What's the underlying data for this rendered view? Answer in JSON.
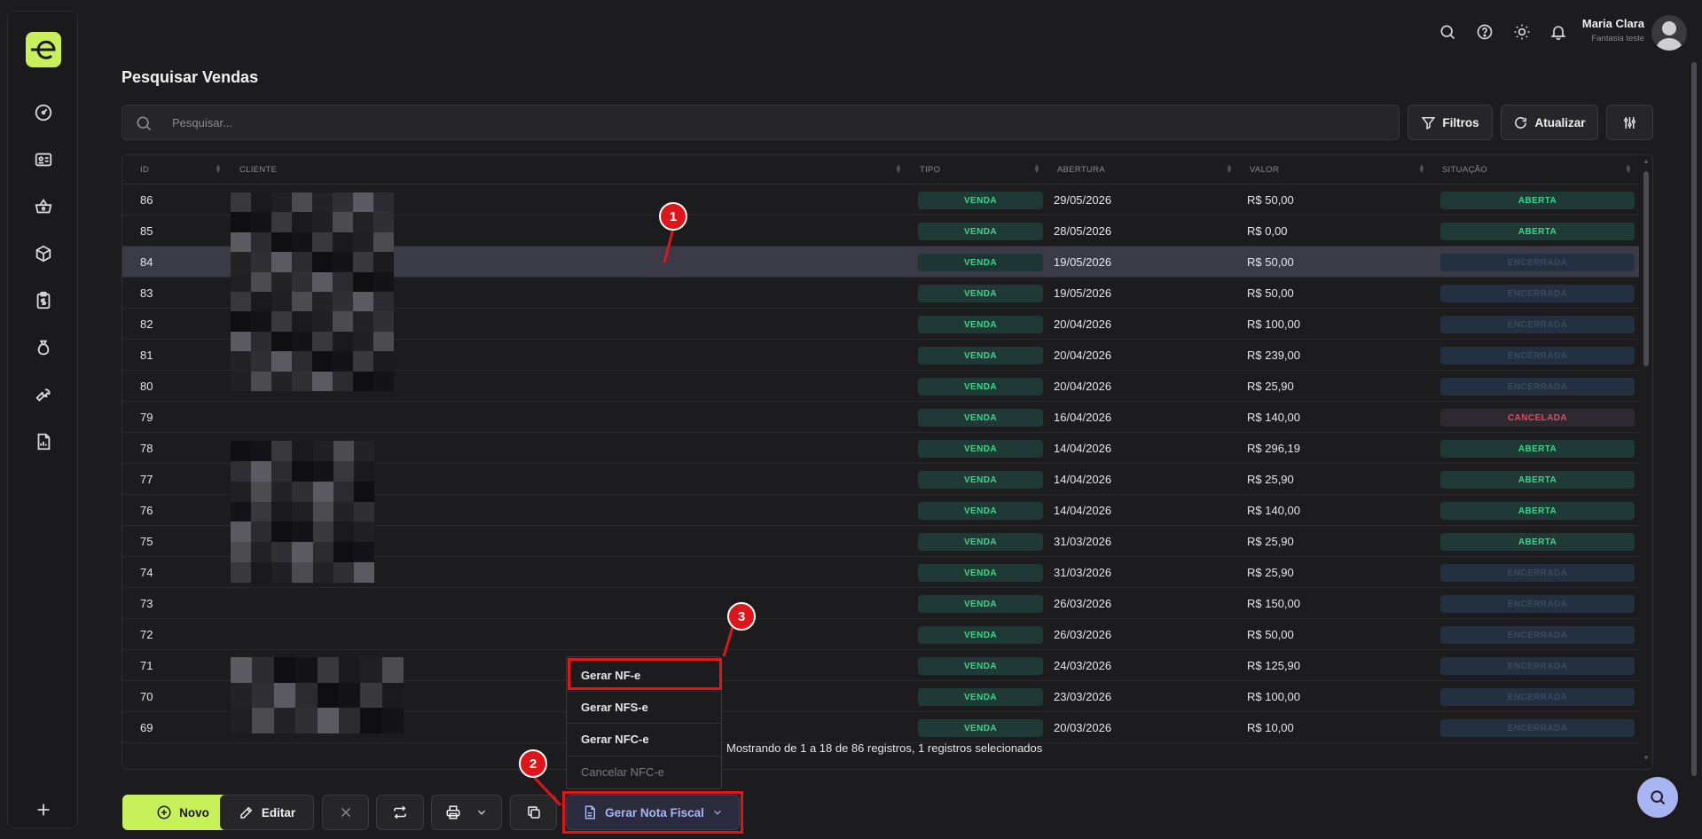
{
  "app": {
    "logo_text": "e",
    "accent": "#c8f05a"
  },
  "sidebar": {
    "items": [
      {
        "name": "dashboard-icon"
      },
      {
        "name": "id-card-icon"
      },
      {
        "name": "basket-icon"
      },
      {
        "name": "box-icon"
      },
      {
        "name": "clipboard-money-icon"
      },
      {
        "name": "money-bag-icon"
      },
      {
        "name": "wrench-icon"
      },
      {
        "name": "report-icon"
      }
    ],
    "add_icon": "plus-icon"
  },
  "topbar": {
    "user_name": "Maria Clara",
    "user_company": "Fantasia teste"
  },
  "page": {
    "title": "Pesquisar Vendas"
  },
  "search": {
    "placeholder": "Pesquisar..."
  },
  "toolbar": {
    "filters_label": "Filtros",
    "refresh_label": "Atualizar"
  },
  "table": {
    "columns": [
      "ID",
      "CLIENTE",
      "TIPO",
      "ABERTURA",
      "VALOR",
      "SITUAÇÃO"
    ],
    "rows": [
      {
        "id": "86",
        "tipo": "VENDA",
        "abertura": "29/05/2026",
        "valor": "R$ 50,00",
        "situacao": "ABERTA",
        "status": "aberta"
      },
      {
        "id": "85",
        "tipo": "VENDA",
        "abertura": "28/05/2026",
        "valor": "R$ 0,00",
        "situacao": "ABERTA",
        "status": "aberta"
      },
      {
        "id": "84",
        "tipo": "VENDA",
        "abertura": "19/05/2026",
        "valor": "R$ 50,00",
        "situacao": "ENCERRADA",
        "status": "encerrada",
        "selected": true
      },
      {
        "id": "83",
        "tipo": "VENDA",
        "abertura": "19/05/2026",
        "valor": "R$ 50,00",
        "situacao": "ENCERRADA",
        "status": "encerrada"
      },
      {
        "id": "82",
        "tipo": "VENDA",
        "abertura": "20/04/2026",
        "valor": "R$ 100,00",
        "situacao": "ENCERRADA",
        "status": "encerrada"
      },
      {
        "id": "81",
        "tipo": "VENDA",
        "abertura": "20/04/2026",
        "valor": "R$ 239,00",
        "situacao": "ENCERRADA",
        "status": "encerrada"
      },
      {
        "id": "80",
        "tipo": "VENDA",
        "abertura": "20/04/2026",
        "valor": "R$ 25,90",
        "situacao": "ENCERRADA",
        "status": "encerrada"
      },
      {
        "id": "79",
        "tipo": "VENDA",
        "abertura": "16/04/2026",
        "valor": "R$ 140,00",
        "situacao": "CANCELADA",
        "status": "cancelada"
      },
      {
        "id": "78",
        "tipo": "VENDA",
        "abertura": "14/04/2026",
        "valor": "R$ 296,19",
        "situacao": "ABERTA",
        "status": "aberta"
      },
      {
        "id": "77",
        "tipo": "VENDA",
        "abertura": "14/04/2026",
        "valor": "R$ 25,90",
        "situacao": "ABERTA",
        "status": "aberta"
      },
      {
        "id": "76",
        "tipo": "VENDA",
        "abertura": "14/04/2026",
        "valor": "R$ 140,00",
        "situacao": "ABERTA",
        "status": "aberta"
      },
      {
        "id": "75",
        "tipo": "VENDA",
        "abertura": "31/03/2026",
        "valor": "R$ 25,90",
        "situacao": "ABERTA",
        "status": "aberta"
      },
      {
        "id": "74",
        "tipo": "VENDA",
        "abertura": "31/03/2026",
        "valor": "R$ 25,90",
        "situacao": "ENCERRADA",
        "status": "encerrada"
      },
      {
        "id": "73",
        "tipo": "VENDA",
        "abertura": "26/03/2026",
        "valor": "R$ 150,00",
        "situacao": "ENCERRADA",
        "status": "encerrada"
      },
      {
        "id": "72",
        "tipo": "VENDA",
        "abertura": "26/03/2026",
        "valor": "R$ 50,00",
        "situacao": "ENCERRADA",
        "status": "encerrada"
      },
      {
        "id": "71",
        "tipo": "VENDA",
        "abertura": "24/03/2026",
        "valor": "R$ 125,90",
        "situacao": "ENCERRADA",
        "status": "encerrada"
      },
      {
        "id": "70",
        "tipo": "VENDA",
        "abertura": "23/03/2026",
        "valor": "R$ 100,00",
        "situacao": "ENCERRADA",
        "status": "encerrada"
      },
      {
        "id": "69",
        "tipo": "VENDA",
        "abertura": "20/03/2026",
        "valor": "R$ 10,00",
        "situacao": "ENCERRADA",
        "status": "encerrada"
      }
    ],
    "footer": "Mostrando de 1 a 18 de 86 registros, 1 registros selecionados"
  },
  "dropdown": {
    "items": [
      {
        "label": "Gerar NF-e",
        "disabled": false
      },
      {
        "label": "Gerar NFS-e",
        "disabled": false
      },
      {
        "label": "Gerar NFC-e",
        "disabled": false
      },
      {
        "label": "Cancelar NFC-e",
        "disabled": true
      }
    ]
  },
  "actions": {
    "new_label": "Novo",
    "edit_label": "Editar",
    "invoice_label": "Gerar Nota Fiscal"
  },
  "markers": [
    "1",
    "2",
    "3"
  ],
  "colors": {
    "status_aberta": "#3ed58a",
    "status_cancelada": "#e84a5f",
    "highlight": "#e0151b",
    "new_button": "#c8f05a"
  }
}
